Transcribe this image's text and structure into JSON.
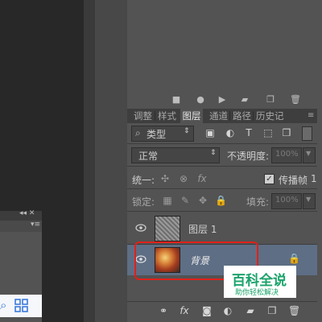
{
  "tabs": [
    "调整",
    "样式",
    "图层",
    "通道",
    "路径",
    "历史记",
    "≡"
  ],
  "active_tab": "图层",
  "filter": {
    "kind_label": "类型"
  },
  "blend": {
    "mode": "正常",
    "opacity_label": "不透明度:",
    "opacity_value": "100%"
  },
  "unify": {
    "label": "统一:",
    "propagate_label": "传播帧",
    "propagate_value": "1"
  },
  "lock": {
    "label": "锁定:",
    "fill_label": "填充:",
    "fill_value": "100%"
  },
  "layers": [
    {
      "name": "图层 1",
      "selected": false
    },
    {
      "name": "背景",
      "selected": true
    }
  ],
  "watermark": {
    "title": "百科全说",
    "subtitle": "助你轻松解决"
  },
  "left_panel": {
    "header_icons": "◂◂ ✕"
  },
  "colors": {
    "panel": "#535353",
    "highlight": "#5e6e85",
    "annotation": "#e0201b",
    "watermark_green": "#1aa36a"
  }
}
